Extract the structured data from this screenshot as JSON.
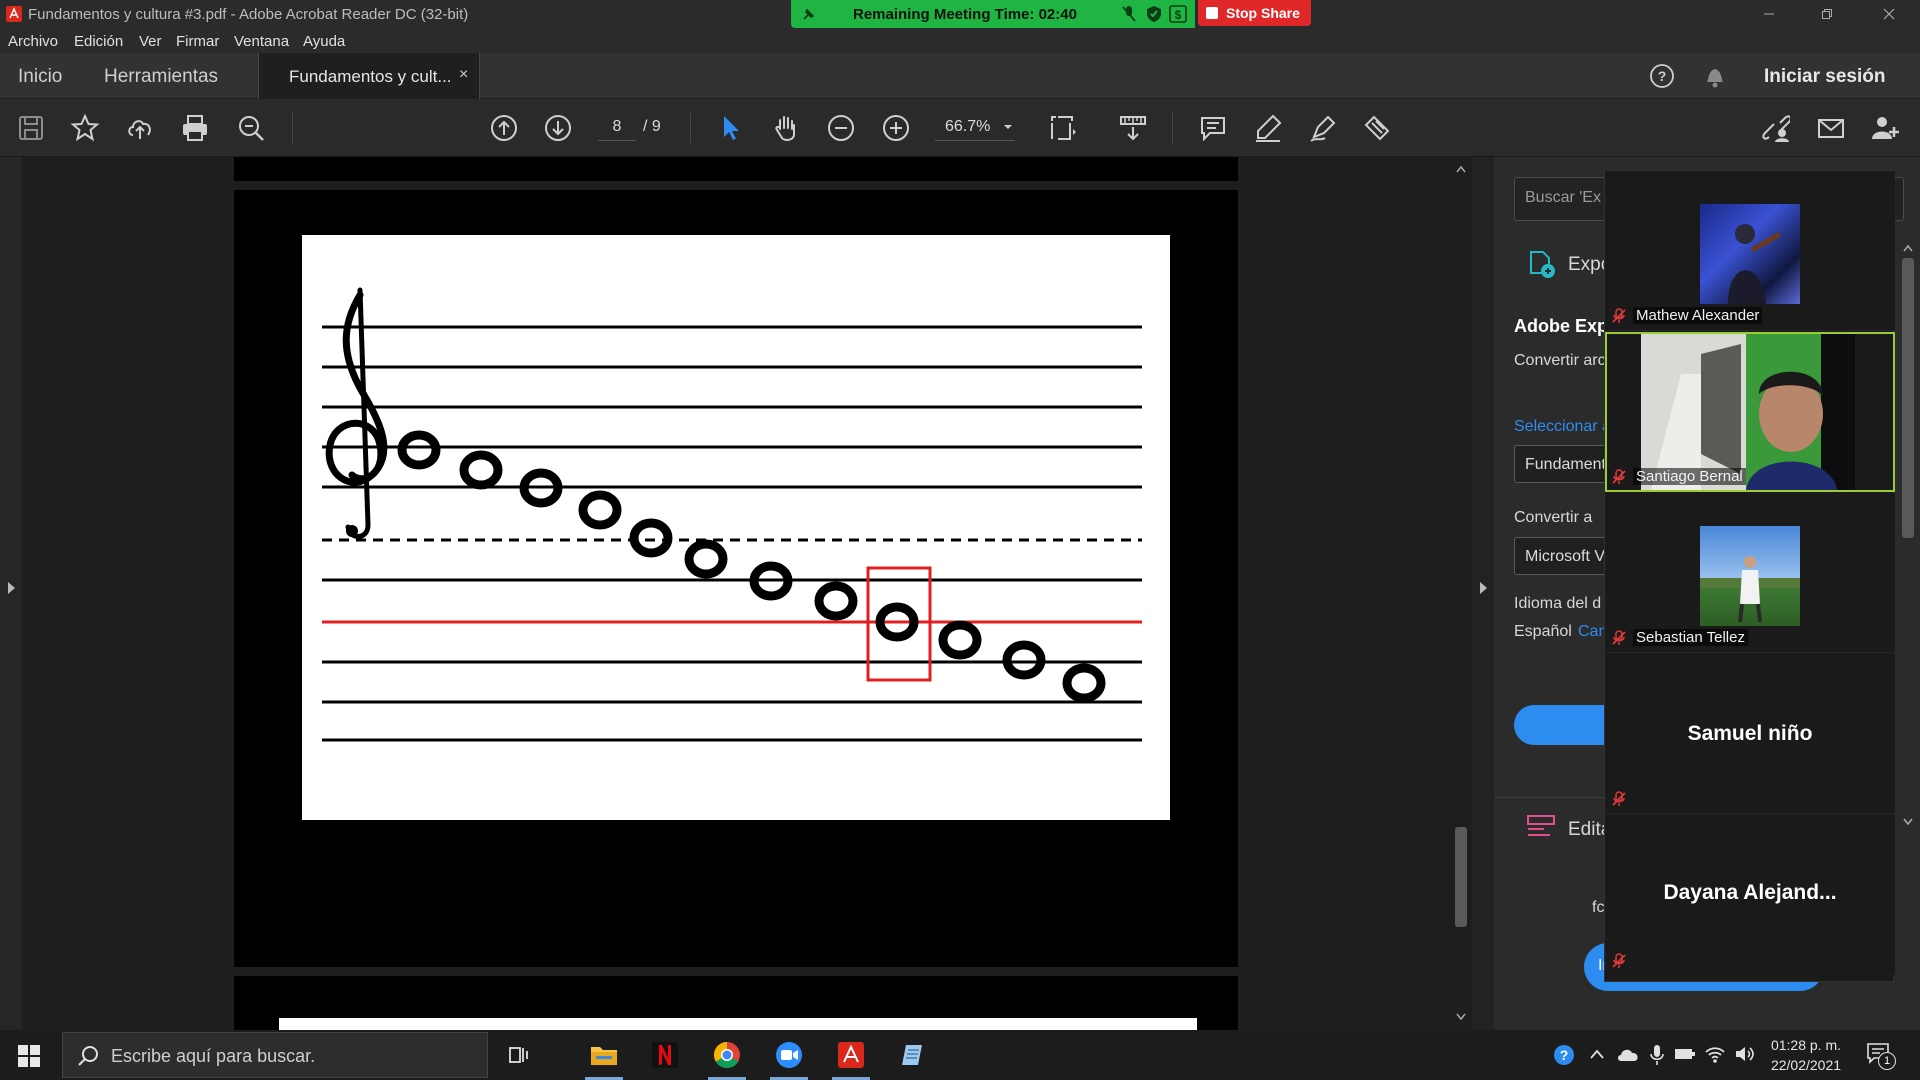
{
  "window": {
    "title": "Fundamentos y cultura #3.pdf - Adobe Acrobat Reader DC (32-bit)"
  },
  "zoom_bar": {
    "timer_text": "Remaining Meeting Time: 02:40",
    "stop_share": "Stop Share"
  },
  "menu": [
    "Archivo",
    "Edición",
    "Ver",
    "Firmar",
    "Ventana",
    "Ayuda"
  ],
  "tabs": {
    "home": "Inicio",
    "tools": "Herramientas",
    "document": "Fundamentos y cult...",
    "close": "×",
    "sign_in": "Iniciar sesión"
  },
  "toolbar": {
    "page_current": "8",
    "page_total": "/ 9",
    "zoom": "66.7%"
  },
  "right_pane": {
    "search_placeholder": "Buscar 'Ex",
    "export_label": "Expo",
    "heading": "Adobe Exp",
    "convert_desc": "Convertir arc",
    "select_link": "Seleccionar a",
    "file_value": "Fundament",
    "convert_to": "Convertir a",
    "format_value": "Microsoft V",
    "lang_label": "Idioma del d",
    "lang_value": "Español",
    "lang_change": "Cam",
    "edit_label": "Edita",
    "footer_text": "fc",
    "footer_btn": "Ir"
  },
  "participants": [
    {
      "name": "Mathew Alexander",
      "type": "thumb"
    },
    {
      "name": "Santiago Bernal",
      "type": "video"
    },
    {
      "name": "Sebastian Tellez",
      "type": "thumb"
    },
    {
      "name": "Samuel niño",
      "type": "text"
    },
    {
      "name": "Dayana  Alejand...",
      "type": "text"
    }
  ],
  "taskbar": {
    "search_placeholder": "Escribe aquí para buscar.",
    "time": "01:28 p. m.",
    "date": "22/02/2021",
    "notifications": "1"
  },
  "colors": {
    "timer_green": "#1fb542",
    "stop_red": "#e02828",
    "acrobat_blue": "#2d8cf0",
    "staff_red": "#e02020",
    "highlight_box": "#e02020"
  }
}
